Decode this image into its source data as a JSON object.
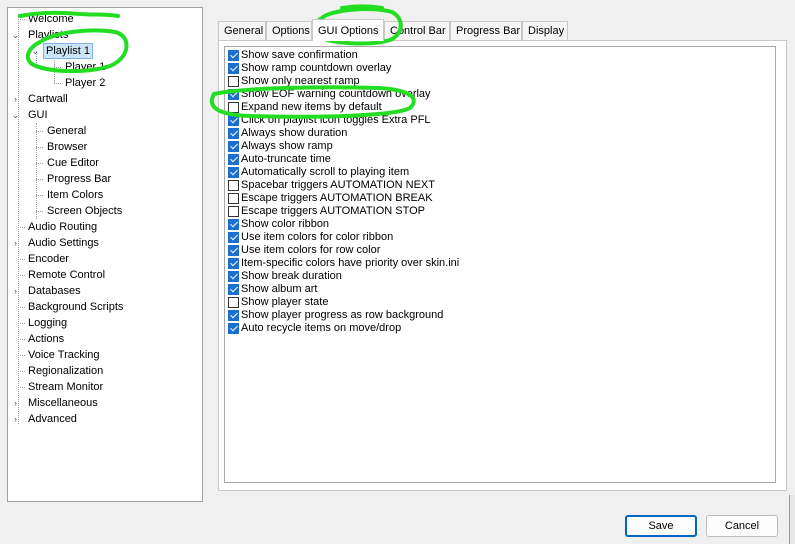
{
  "tree": {
    "items": [
      {
        "label": "Welcome"
      },
      {
        "label": "Playlists"
      },
      {
        "label": "Playlist 1"
      },
      {
        "label": "Player 1"
      },
      {
        "label": "Player 2"
      },
      {
        "label": "Cartwall"
      },
      {
        "label": "GUI"
      },
      {
        "label": "General"
      },
      {
        "label": "Browser"
      },
      {
        "label": "Cue Editor"
      },
      {
        "label": "Progress Bar"
      },
      {
        "label": "Item Colors"
      },
      {
        "label": "Screen Objects"
      },
      {
        "label": "Audio Routing"
      },
      {
        "label": "Audio Settings"
      },
      {
        "label": "Encoder"
      },
      {
        "label": "Remote Control"
      },
      {
        "label": "Databases"
      },
      {
        "label": "Background Scripts"
      },
      {
        "label": "Logging"
      },
      {
        "label": "Actions"
      },
      {
        "label": "Voice Tracking"
      },
      {
        "label": "Regionalization"
      },
      {
        "label": "Stream Monitor"
      },
      {
        "label": "Miscellaneous"
      },
      {
        "label": "Advanced"
      }
    ],
    "selected": "Playlist 1"
  },
  "tabs": [
    {
      "label": "General"
    },
    {
      "label": "Options"
    },
    {
      "label": "GUI Options"
    },
    {
      "label": "Control Bar"
    },
    {
      "label": "Progress Bar"
    },
    {
      "label": "Display"
    }
  ],
  "active_tab": "GUI Options",
  "options": [
    {
      "label": "Show save confirmation",
      "checked": true
    },
    {
      "label": "Show ramp countdown overlay",
      "checked": true
    },
    {
      "label": "Show only nearest ramp",
      "checked": false
    },
    {
      "label": "Show EOF warning countdown overlay",
      "checked": true
    },
    {
      "label": "Expand new items by default",
      "checked": false
    },
    {
      "label": "Click on playlist icon toggles Extra PFL",
      "checked": true
    },
    {
      "label": "Always show duration",
      "checked": true
    },
    {
      "label": "Always show ramp",
      "checked": true
    },
    {
      "label": "Auto-truncate time",
      "checked": true
    },
    {
      "label": "Automatically scroll to playing item",
      "checked": true
    },
    {
      "label": "Spacebar triggers AUTOMATION NEXT",
      "checked": false
    },
    {
      "label": "Escape triggers AUTOMATION BREAK",
      "checked": false
    },
    {
      "label": "Escape triggers AUTOMATION STOP",
      "checked": false
    },
    {
      "label": "Show color ribbon",
      "checked": true
    },
    {
      "label": "Use item colors for color ribbon",
      "checked": true
    },
    {
      "label": "Use item colors for row color",
      "checked": true
    },
    {
      "label": "Item-specific colors have priority over skin.ini",
      "checked": true
    },
    {
      "label": "Show break duration",
      "checked": true
    },
    {
      "label": "Show album art",
      "checked": true
    },
    {
      "label": "Show player state",
      "checked": false
    },
    {
      "label": "Show player progress as row background",
      "checked": true
    },
    {
      "label": "Auto recycle items on move/drop",
      "checked": true
    }
  ],
  "buttons": {
    "save": "Save",
    "cancel": "Cancel"
  },
  "colors": {
    "accent": "#1a6fd1",
    "annotation": "#22dd22",
    "selection": "#cce4f7"
  }
}
